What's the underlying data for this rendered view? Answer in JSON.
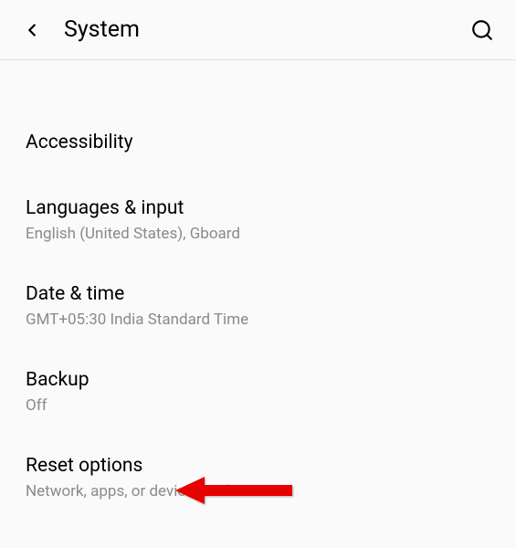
{
  "header": {
    "title": "System"
  },
  "items": [
    {
      "title": "Accessibility",
      "subtitle": null
    },
    {
      "title": "Languages & input",
      "subtitle": "English (United States), Gboard"
    },
    {
      "title": "Date & time",
      "subtitle": "GMT+05:30 India Standard Time"
    },
    {
      "title": "Backup",
      "subtitle": "Off"
    },
    {
      "title": "Reset options",
      "subtitle": "Network, apps, or device can be reset"
    }
  ]
}
